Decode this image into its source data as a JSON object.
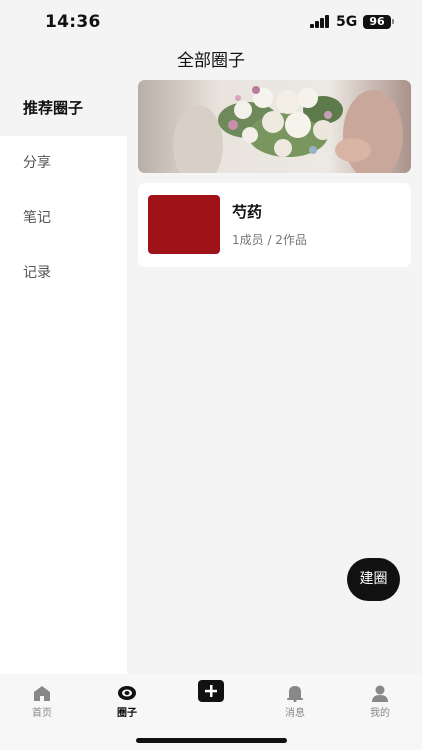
{
  "status_bar": {
    "time": "14:36",
    "network": "5G",
    "battery": "96"
  },
  "header": {
    "title": "全部圈子"
  },
  "sidebar": {
    "items": [
      {
        "label": "推荐圈子",
        "active": true
      },
      {
        "label": "分享",
        "active": false
      },
      {
        "label": "笔记",
        "active": false
      },
      {
        "label": "记录",
        "active": false
      }
    ]
  },
  "circle_card": {
    "title": "芍药",
    "meta": "1成员 / 2作品"
  },
  "fab": {
    "label": "建圈"
  },
  "tabbar": {
    "items": [
      {
        "label": "首页",
        "icon": "home-icon",
        "active": false
      },
      {
        "label": "圈子",
        "icon": "eye-icon",
        "active": true
      },
      {
        "label": "",
        "icon": "plus-icon",
        "active": false
      },
      {
        "label": "消息",
        "icon": "bell-icon",
        "active": false
      },
      {
        "label": "我的",
        "icon": "person-icon",
        "active": false
      }
    ]
  },
  "colors": {
    "accent": "#111111",
    "thumbnail": "#9e1218",
    "background": "#f4f4f4"
  }
}
